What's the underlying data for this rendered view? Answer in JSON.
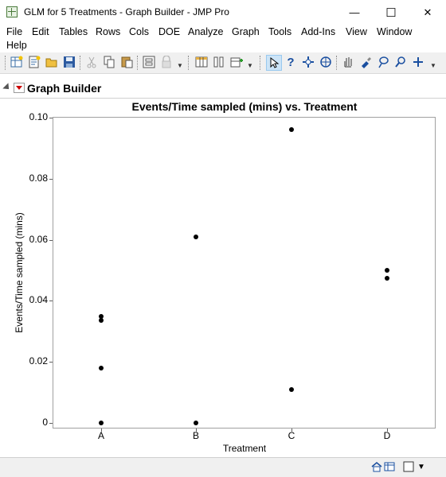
{
  "window": {
    "title": "GLM for 5 Treatments - Graph Builder - JMP Pro",
    "minimize_glyph": "—",
    "maximize_glyph": "☐",
    "close_glyph": "✕"
  },
  "menu": [
    "File",
    "Edit",
    "Tables",
    "Rows",
    "Cols",
    "DOE",
    "Analyze",
    "Graph",
    "Tools",
    "Add-Ins",
    "View",
    "Window",
    "Help"
  ],
  "toolbar": {
    "icons": [
      "new-data-table-icon",
      "new-script-icon",
      "open-icon",
      "save-icon",
      "cut-icon",
      "copy-icon",
      "paste-icon",
      "script-icon",
      "lock-icon",
      "data-grid-icon",
      "columns-icon",
      "add-table-icon",
      "arrow-select-icon",
      "help-question-icon",
      "crosshair-icon",
      "target-icon",
      "hand-icon",
      "brush-icon",
      "lasso-icon",
      "magnifier-icon",
      "plus-icon"
    ]
  },
  "graph_builder": {
    "title": "Graph Builder"
  },
  "chart_data": {
    "type": "scatter",
    "title": "Events/Time sampled (mins) vs. Treatment",
    "xlabel": "Treatment",
    "ylabel": "Events/Time sampled (mins)",
    "categories": [
      "A",
      "B",
      "C",
      "D"
    ],
    "yticks": [
      "0",
      "0.02",
      "0.04",
      "0.06",
      "0.08",
      "0.10"
    ],
    "ylim": [
      0,
      0.1
    ],
    "points": [
      {
        "x": "A",
        "y": 0.035
      },
      {
        "x": "A",
        "y": 0.0335
      },
      {
        "x": "A",
        "y": 0.018
      },
      {
        "x": "A",
        "y": 0
      },
      {
        "x": "B",
        "y": 0.061
      },
      {
        "x": "B",
        "y": 0
      },
      {
        "x": "C",
        "y": 0.096
      },
      {
        "x": "C",
        "y": 0.011
      },
      {
        "x": "D",
        "y": 0.05
      },
      {
        "x": "D",
        "y": 0.0475
      }
    ],
    "grid": false
  },
  "statusbar": {
    "icons": [
      "home-icon",
      "table-window-icon",
      "window-select-icon",
      "dropdown-arrow-icon"
    ]
  }
}
